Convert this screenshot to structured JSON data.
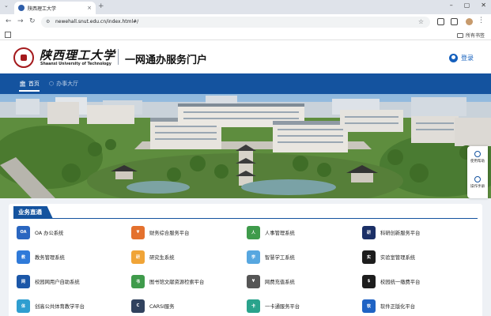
{
  "browser": {
    "tab_title": "陕西理工大学",
    "tab_close": "×",
    "new_tab": "+",
    "url": "newehall.snut.edu.cn/index.html#/",
    "all_bookmarks": "所有书签"
  },
  "header": {
    "logo_cn": "陕西理工大学",
    "logo_en": "Shaanxi University of Technology",
    "portal_title": "一网通办服务门户",
    "login": "登录"
  },
  "nav": {
    "items": [
      {
        "label": "首页",
        "icon": "bank-icon"
      },
      {
        "label": "办事大厅",
        "icon": "cube-icon"
      }
    ]
  },
  "float": {
    "help": "使用帮助",
    "manual": "操作手册"
  },
  "biz": {
    "section_title": "业务直通",
    "services": [
      {
        "label": "OA 办公系统",
        "icon": "oa-icon",
        "color": "#2a66c0",
        "short": "OA"
      },
      {
        "label": "财务综合服务平台",
        "icon": "finance-icon",
        "color": "#e4712e",
        "short": "¥"
      },
      {
        "label": "人事管理系统",
        "icon": "personnel-icon",
        "color": "#3f9b4b",
        "short": "人"
      },
      {
        "label": "科研创新服务平台",
        "icon": "research-icon",
        "color": "#1b2f66",
        "short": "研"
      },
      {
        "label": "教务管理系统",
        "icon": "academic-icon",
        "color": "#2f7ad9",
        "short": "教"
      },
      {
        "label": "研究生系统",
        "icon": "graduate-icon",
        "color": "#f0a437",
        "short": "研"
      },
      {
        "label": "智慧学工系统",
        "icon": "student-affairs-icon",
        "color": "#57a7e0",
        "short": "学"
      },
      {
        "label": "实验室管理系统",
        "icon": "lab-icon",
        "color": "#1d1d1d",
        "short": "实"
      },
      {
        "label": "校园网用户自助系统",
        "icon": "network-icon",
        "color": "#1b57a8",
        "short": "网"
      },
      {
        "label": "图书馆文献资源检索平台",
        "icon": "library-icon",
        "color": "#3f9b4b",
        "short": "书"
      },
      {
        "label": "网费充值系统",
        "icon": "recharge-icon",
        "color": "#555555",
        "short": "¥"
      },
      {
        "label": "校园统一缴费平台",
        "icon": "payment-icon",
        "color": "#1d1d1d",
        "short": "$"
      },
      {
        "label": "创高公共体育教学平台",
        "icon": "sports-icon",
        "color": "#2f9ed0",
        "short": "体"
      },
      {
        "label": "CARSI服务",
        "icon": "carsi-icon",
        "color": "#31425e",
        "short": "C"
      },
      {
        "label": "一卡通服务平台",
        "icon": "card-icon",
        "color": "#2aa38c",
        "short": "卡"
      },
      {
        "label": "软件正版化平台",
        "icon": "software-icon",
        "color": "#1f63c4",
        "short": "软"
      }
    ]
  }
}
